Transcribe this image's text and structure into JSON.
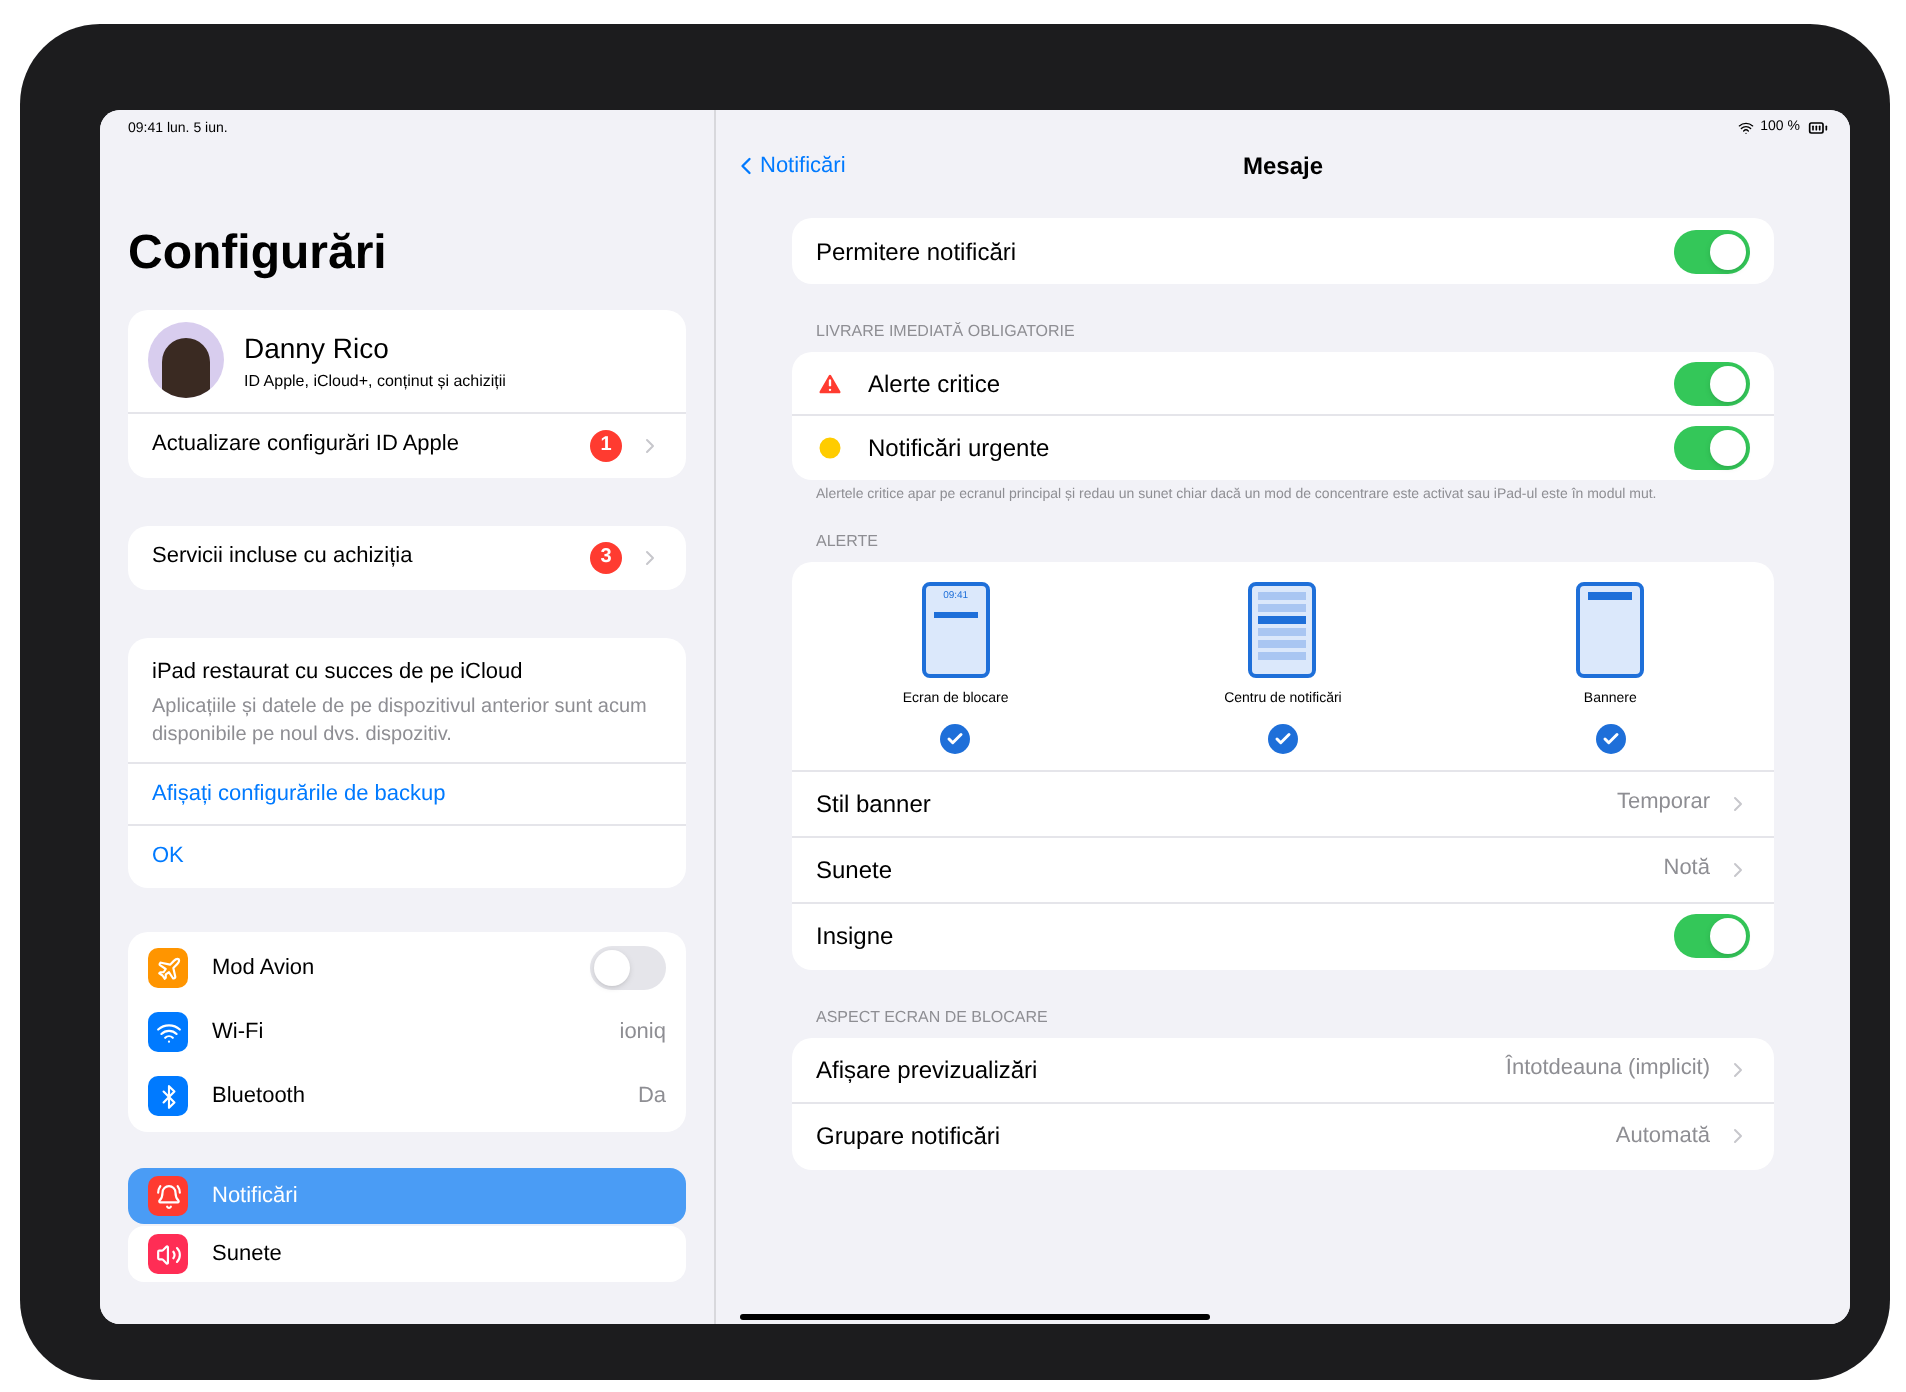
{
  "status_bar": {
    "time": "09:41 lun. 5 iun.",
    "battery": "100 %"
  },
  "sidebar": {
    "title": "Configurări",
    "profile": {
      "name": "Danny Rico",
      "subtitle": "ID Apple, iCloud+, conținut și achiziții"
    },
    "update_row": {
      "label": "Actualizare configurări ID Apple",
      "badge": "1"
    },
    "services_row": {
      "label": "Servicii incluse cu achiziția",
      "badge": "3"
    },
    "restore_card": {
      "title": "iPad restaurat cu succes de pe iCloud",
      "text": "Aplicațiile și datele de pe dispozitivul anterior sunt acum disponibile pe noul dvs. dispozitiv.",
      "link": "Afișați configurările de backup",
      "ok": "OK"
    },
    "items": [
      {
        "kind": "toggle",
        "label": "Mod Avion",
        "on": false
      },
      {
        "kind": "value",
        "label": "Wi-Fi",
        "value": "ioniq"
      },
      {
        "kind": "value",
        "label": "Bluetooth",
        "value": "Da"
      }
    ],
    "nav_items": [
      {
        "label": "Notificări",
        "selected": true
      },
      {
        "label": "Sunete",
        "selected": false
      }
    ]
  },
  "detail": {
    "back": "Notificări",
    "title": "Mesaje",
    "allow": {
      "kind": "toggle",
      "label": "Permitere notificări",
      "on": true
    },
    "immediate_header": "LIVRARE IMEDIATĂ OBLIGATORIE",
    "immediate": [
      {
        "label": "Alerte critice",
        "on": true
      },
      {
        "label": "Notificări urgente",
        "on": true
      }
    ],
    "immediate_footer": "Alertele critice apar pe ecranul principal și redau un sunet chiar dacă un mod de concentrare este activat sau iPad-ul este în modul mut.",
    "alerts_header": "ALERTE",
    "alert_styles": [
      {
        "kind": "lock",
        "label": "Ecran de blocare",
        "time": "09:41",
        "checked": true
      },
      {
        "kind": "center",
        "label": "Centru de notificări",
        "checked": true
      },
      {
        "kind": "banner",
        "label": "Bannere",
        "checked": true
      }
    ],
    "alert_rows": [
      {
        "kind": "value",
        "label": "Stil banner",
        "value": "Temporar"
      },
      {
        "kind": "value",
        "label": "Sunete",
        "value": "Notă"
      },
      {
        "kind": "toggle",
        "label": "Insigne",
        "on": true
      }
    ],
    "lock_header": "ASPECT ECRAN DE BLOCARE",
    "lock_rows": [
      {
        "kind": "value",
        "label": "Afișare previzualizări",
        "value": "Întotdeauna (implicit)"
      },
      {
        "kind": "value",
        "label": "Grupare notificări",
        "value": "Automată"
      }
    ]
  }
}
